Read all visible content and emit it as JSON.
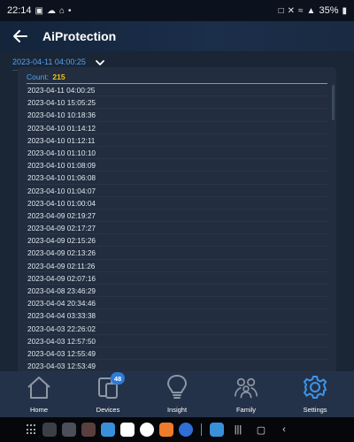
{
  "status_bar": {
    "time": "22:14",
    "battery": "35%",
    "left_icons": [
      "photo-icon",
      "cloud-icon",
      "home-icon",
      "dot-icon"
    ],
    "right_icons": [
      "nfc-icon",
      "mute-icon",
      "wifi-icon",
      "signal-icon",
      "battery-icon"
    ]
  },
  "header": {
    "title": "AiProtection",
    "back_icon": "back-arrow-icon"
  },
  "date_selector": {
    "value": "2023-04-11 04:00:25"
  },
  "log": {
    "count_label": "Count:",
    "count_value": "215",
    "entries": [
      "2023-04-11 04:00:25",
      "2023-04-10 15:05:25",
      "2023-04-10 10:18:36",
      "2023-04-10 01:14:12",
      "2023-04-10 01:12:11",
      "2023-04-10 01:10:10",
      "2023-04-10 01:08:09",
      "2023-04-10 01:06:08",
      "2023-04-10 01:04:07",
      "2023-04-10 01:00:04",
      "2023-04-09 02:19:27",
      "2023-04-09 02:17:27",
      "2023-04-09 02:15:26",
      "2023-04-09 02:13:26",
      "2023-04-09 02:11:26",
      "2023-04-09 02:07:16",
      "2023-04-08 23:46:29",
      "2023-04-04 20:34:46",
      "2023-04-04 03:33:38",
      "2023-04-03 22:26:02",
      "2023-04-03 12:57:50",
      "2023-04-03 12:55:49",
      "2023-04-03 12:53:49"
    ]
  },
  "bottom_nav": {
    "items": [
      {
        "label": "Home",
        "icon": "home-icon"
      },
      {
        "label": "Devices",
        "icon": "devices-icon",
        "badge": "48"
      },
      {
        "label": "Insight",
        "icon": "lightbulb-icon"
      },
      {
        "label": "Family",
        "icon": "family-icon"
      },
      {
        "label": "Settings",
        "icon": "gear-icon",
        "active": true
      }
    ]
  },
  "colors": {
    "accent": "#53a4f2",
    "count": "#f0c419",
    "nav_bg": "#243249",
    "header_bg": "#1b2e4a",
    "active_icon": "#3d95ea"
  }
}
